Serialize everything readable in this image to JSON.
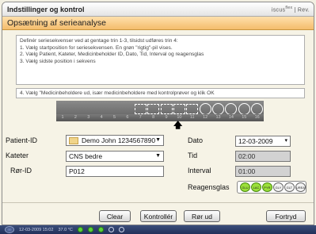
{
  "window": {
    "title": "Indstillinger og kontrol",
    "brand": "iscus",
    "brand_sup": "flex",
    "brand_suffix": "| Rev."
  },
  "section": {
    "title": "Opsætning af serieanalyse"
  },
  "instructions": {
    "lines": [
      "Definér seriesekvenser ved at gentage trin 1-3, tilsidst udføres trin 4:",
      "1. Vælg startposition for seriesekvensen. En grøn \"rigtig\"-pil vises.",
      "2. Vælg Patient, Kateter, Medicinbeholder ID, Dato, Tid, Interval og reagensglas",
      "3. Vælg sidste position i sekvens"
    ],
    "step4": "4. Vælg \"Medicinbeholdere ud, især medicinbeholdere med kontrolprøver og klik OK"
  },
  "sequence": {
    "positions": [
      "1",
      "2",
      "3",
      "4",
      "5",
      "6",
      "7",
      "8",
      "9",
      "10",
      "11",
      "12",
      "13",
      "14",
      "15",
      "16"
    ]
  },
  "form": {
    "patient_label": "Patient-ID",
    "patient_value": "Demo John 1234567890",
    "kateter_label": "Kateter",
    "kateter_value": "CNS bedre",
    "ror_label": "Rør-ID",
    "ror_value": "P012",
    "dato_label": "Dato",
    "dato_value": "12-03-2009",
    "tid_label": "Tid",
    "tid_value": "02:00",
    "interval_label": "Interval",
    "interval_value": "01:00",
    "reagens_label": "Reagensglas",
    "reagents": [
      {
        "name": "GLU",
        "active": true
      },
      {
        "name": "LAC",
        "active": true
      },
      {
        "name": "PYR",
        "active": true
      },
      {
        "name": "GLY",
        "active": false
      },
      {
        "name": "GLT",
        "active": false
      },
      {
        "name": "UREA",
        "active": false
      }
    ]
  },
  "buttons": {
    "clear": "Clear",
    "kontroller": "Kontrollér",
    "ror_ud": "Rør ud",
    "fortryd": "Fortryd"
  },
  "taskbar": {
    "date": "12-03-2009 15:02",
    "status": "37.0 °C"
  },
  "colors": {
    "section_bar": "#f4bc6c",
    "reagent_active": "#9be03a"
  }
}
